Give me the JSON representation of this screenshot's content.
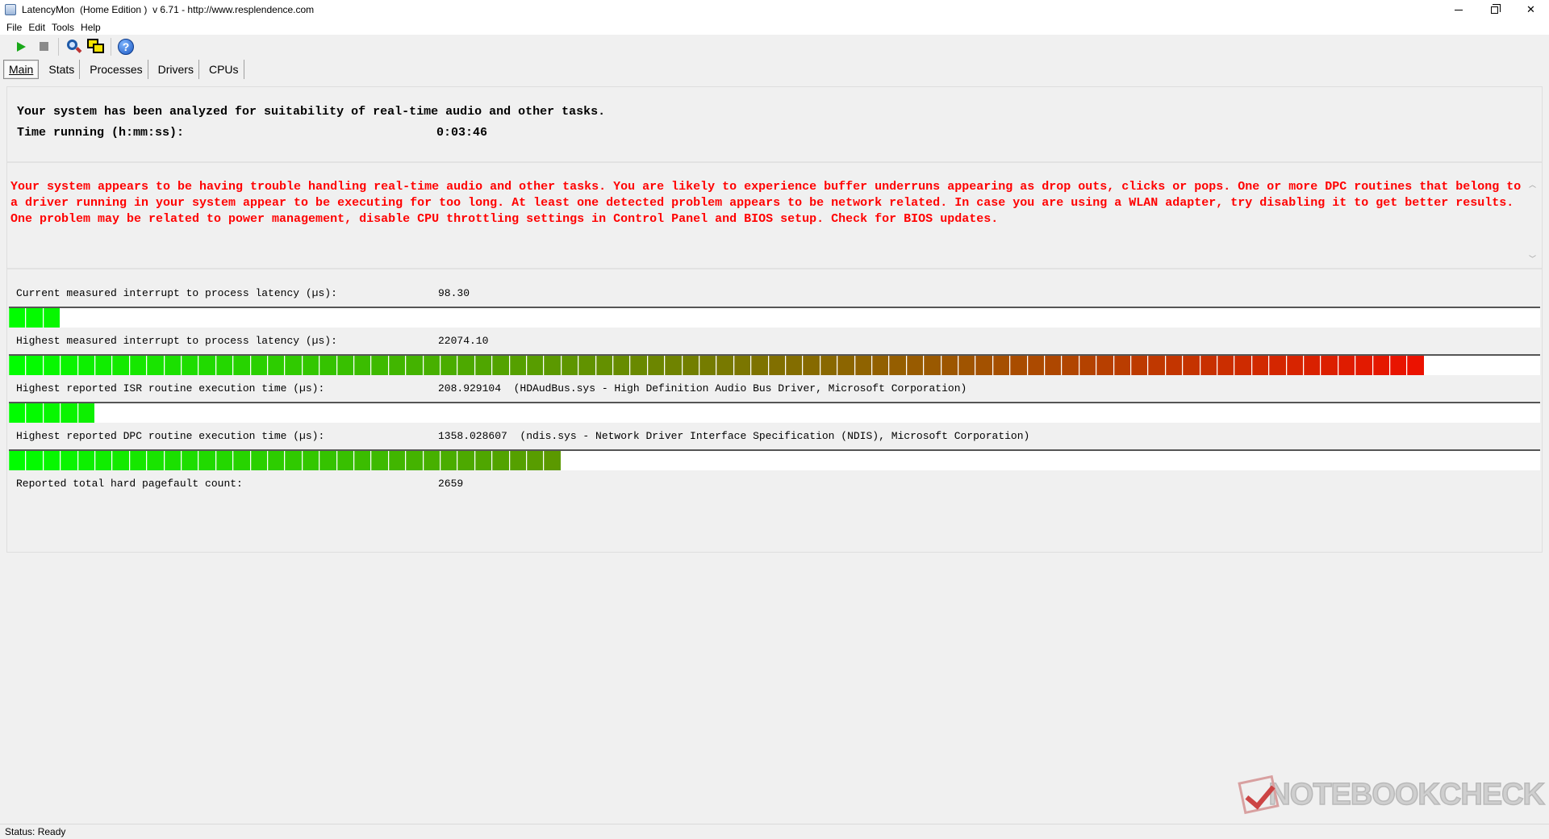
{
  "window": {
    "title": "LatencyMon  (Home Edition )  v 6.71 - http://www.resplendence.com",
    "minimize": "",
    "close": "✕"
  },
  "menu": [
    "File",
    "Edit",
    "Tools",
    "Help"
  ],
  "toolbar": {
    "icons": [
      "play-icon",
      "stop-icon",
      "search-icon",
      "windows-icon",
      "help-icon"
    ],
    "help_glyph": "?"
  },
  "tabs": [
    "Main",
    "Stats",
    "Processes",
    "Drivers",
    "CPUs"
  ],
  "analysis": {
    "line1": "Your system has been analyzed for suitability of real-time audio and other tasks.",
    "time_label": "Time running (h:mm:ss):",
    "time_value": "0:03:46"
  },
  "warning": "Your system appears to be having trouble handling real-time audio and other tasks. You are likely to experience buffer underruns appearing as drop outs, clicks or pops. One or more DPC routines that belong to a driver running in your system appear to be executing for too long. At least one detected problem appears to be network related. In case you are using a WLAN adapter, try disabling it to get better results. One problem may be related to power management, disable CPU throttling settings in Control Panel and BIOS setup. Check for BIOS updates.",
  "metrics": [
    {
      "label": "Current measured interrupt to process latency (µs):",
      "value": "98.30",
      "level": 0.033
    },
    {
      "label": "Highest measured interrupt to process latency (µs):",
      "value": "22074.10",
      "level": 0.93
    },
    {
      "label": "Highest reported ISR routine execution time (µs):",
      "value": "208.929104  (HDAudBus.sys - High Definition Audio Bus Driver, Microsoft Corporation)",
      "level": 0.057
    },
    {
      "label": "Highest reported DPC routine execution time (µs):",
      "value": "1358.028607  (ndis.sys - Network Driver Interface Specification (NDIS), Microsoft Corporation)",
      "level": 0.36
    }
  ],
  "pagefault": {
    "label": "Reported total hard pagefault count:",
    "value": "2659"
  },
  "colors": {
    "warning": "#ff0000",
    "bar_low": "#00ff00",
    "bar_high": "#ff0000"
  },
  "status": "Status: Ready",
  "watermark": "NOTEBOOKCHECK"
}
